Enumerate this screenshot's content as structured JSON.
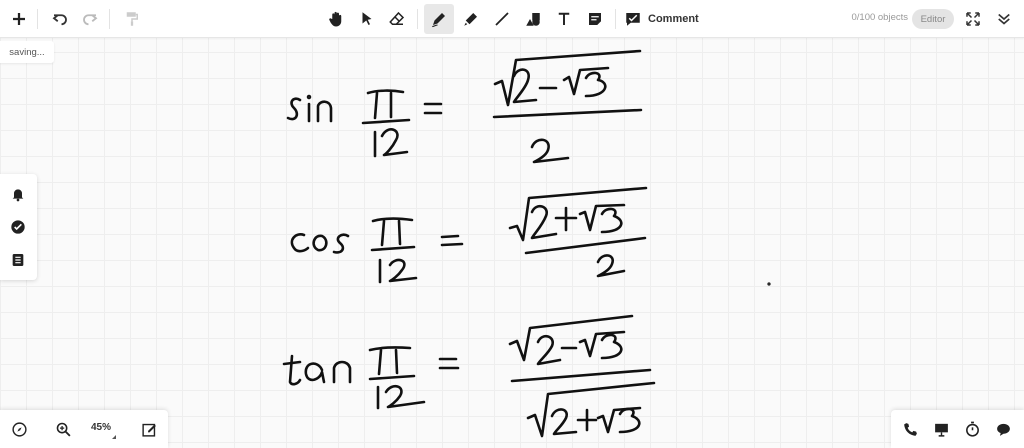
{
  "toolbar": {
    "icons": {
      "add": "plus-icon",
      "undo": "undo-icon",
      "redo": "redo-icon",
      "format_painter": "format-painter-icon",
      "pan": "hand-icon",
      "select": "pointer-icon",
      "eraser": "eraser-icon",
      "pen": "pen-icon",
      "highlighter": "highlighter-icon",
      "line": "line-icon",
      "shapes": "shapes-icon",
      "text": "text-icon",
      "note": "note-icon",
      "comment": "comment-icon",
      "fullscreen": "expand-icon",
      "collapse": "collapse-icon"
    },
    "active_tool": "pen",
    "comment_label": "Comment",
    "objects_count": "0/100 objects",
    "editor_label": "Editor"
  },
  "status": {
    "saving_text": "saving..."
  },
  "left_panel": {
    "icons": [
      "bell-icon",
      "check-circle-icon",
      "list-icon"
    ]
  },
  "bottom_left": {
    "icons": [
      "compass-icon",
      "zoom-in-icon",
      "edit-icon"
    ],
    "zoom_level": "45%"
  },
  "bottom_right": {
    "icons": [
      "phone-icon",
      "presentation-icon",
      "timer-icon",
      "chat-icon"
    ]
  },
  "colors": {
    "toolbar_bg": "#ffffff",
    "canvas_bg": "#fafafa",
    "grid": "#eeeeee",
    "ink": "#111111",
    "active_tool_bg": "#e8e8e8"
  }
}
